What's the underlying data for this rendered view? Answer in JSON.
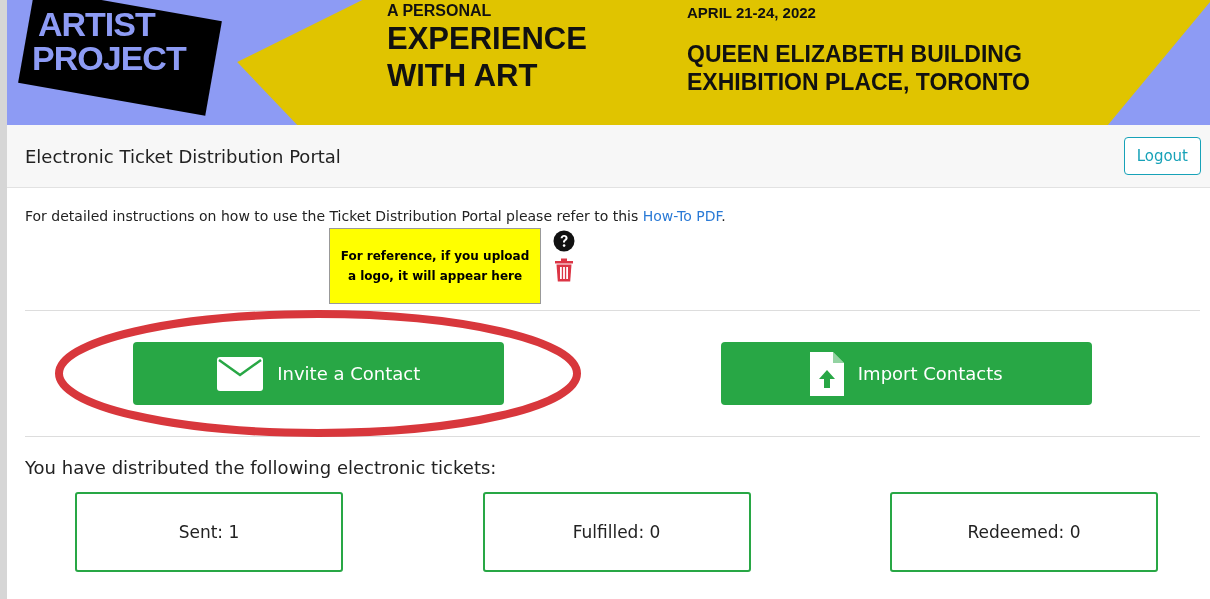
{
  "banner": {
    "logo_lines": [
      "ARTIST",
      "PROJECT"
    ],
    "tagline_lines": [
      "A PERSONAL",
      "EXPERIENCE",
      "WITH ART"
    ],
    "date": "APRIL 21-24, 2022",
    "venue_lines": [
      "QUEEN ELIZABETH BUILDING",
      "EXHIBITION PLACE, TORONTO"
    ]
  },
  "header": {
    "title": "Electronic Ticket Distribution Portal",
    "logout": "Logout"
  },
  "instructions": {
    "text": "For detailed instructions on how to use the Ticket Distribution Portal please refer to this ",
    "link": "How-To PDF",
    "end": "."
  },
  "logo_placeholder": "For reference, if you upload a logo, it will appear here",
  "actions": [
    {
      "kind": "mail",
      "label": "Invite a Contact",
      "highlighted": true
    },
    {
      "kind": "import",
      "label": "Import Contacts",
      "highlighted": false
    }
  ],
  "summary": {
    "heading": "You have distributed the following electronic tickets:",
    "stats": [
      "Sent: 1",
      "Fulfilled: 0",
      "Redeemed: 0"
    ]
  }
}
